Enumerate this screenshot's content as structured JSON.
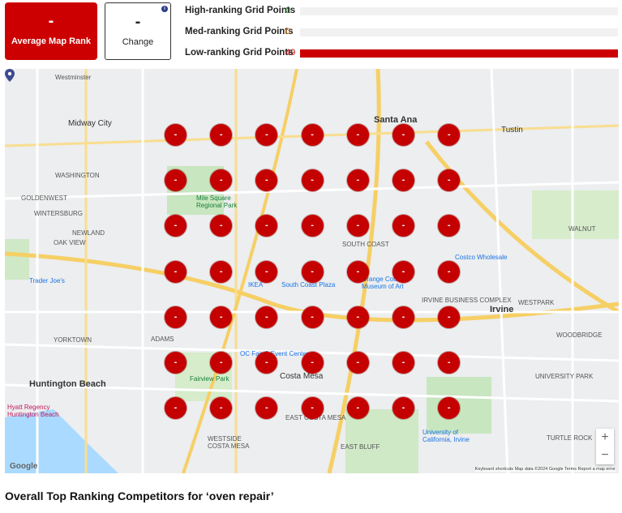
{
  "summary": {
    "average_rank": {
      "value": "-",
      "label": "Average Map Rank"
    },
    "change": {
      "value": "-",
      "label": "Change",
      "info_icon": "info-icon"
    }
  },
  "ranking": {
    "high": {
      "label": "High-ranking Grid Points",
      "count": "0",
      "color": "#2e8b2e",
      "fraction": 0
    },
    "med": {
      "label": "Med-ranking Grid Points",
      "count": "0",
      "color": "#e07000",
      "fraction": 0
    },
    "low": {
      "label": "Low-ranking Grid Points",
      "count": "49",
      "color": "#cc0000",
      "fraction": 1
    }
  },
  "map": {
    "labels": {
      "westminster": "Westminster",
      "midway_city": "Midway City",
      "washington": "WASHINGTON",
      "goldenwest": "GOLDENWEST",
      "wintersburg": "WINTERSBURG",
      "newland": "NEWLAND",
      "oak_view": "OAK VIEW",
      "adams": "ADAMS",
      "yorktown": "YORKTOWN",
      "huntington_beach": "Huntington Beach",
      "hyatt": "Hyatt Regency Huntington Beach",
      "santa_ana": "Santa Ana",
      "tustin": "Tustin",
      "irvine": "Irvine",
      "costa_mesa": "Costa Mesa",
      "south_coast": "SOUTH COAST",
      "east_bluff": "EAST BLUFF",
      "westpark": "WESTPARK",
      "walnut": "WALNUT",
      "woodbridge": "WOODBRIDGE",
      "turtle_rock": "TURTLE ROCK",
      "university_park": "UNIVERSITY PARK",
      "south_coast_plaza": "South Coast Plaza",
      "mile_square": "Mile Square Regional Park",
      "orange_county_museum": "Orange County Museum of Art",
      "costco_wholesale": "Costco Wholesale",
      "trader_joes": "Trader Joe's",
      "ikea": "IKEA",
      "irvine_business": "IRVINE BUSINESS COMPLEX",
      "fairview_park": "Fairview Park",
      "ocfair": "OC Fair & Event Center",
      "uc_irvine": "University of California, Irvine",
      "east_costa_mesa": "EAST COSTA MESA",
      "westside": "WESTSIDE COSTA MESA"
    },
    "pin_label": "-",
    "grid_rows": 7,
    "grid_cols": 7,
    "zoom_in": "+",
    "zoom_out": "−",
    "google": "Google",
    "attribution": "Keyboard shortcuts   Map data ©2024 Google   Terms   Report a map error"
  },
  "section": {
    "title": "Overall Top Ranking Competitors for ‘oven repair’"
  }
}
